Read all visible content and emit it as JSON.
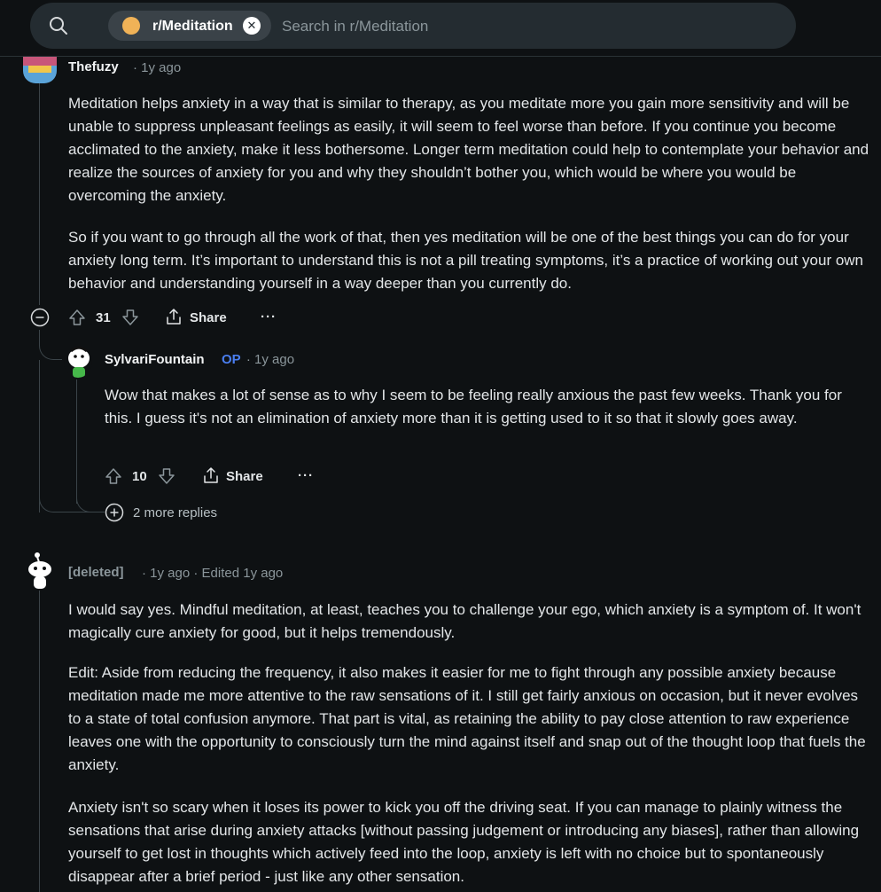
{
  "search": {
    "subreddit_chip": "r/Meditation",
    "chip_close": "✕",
    "placeholder": "Search in r/Meditation"
  },
  "comments": [
    {
      "author": "Thefuzy",
      "time": "· 1y ago",
      "paragraphs": [
        "Meditation helps anxiety in a way that is similar to therapy, as you meditate more you gain more sensitivity and will be unable to suppress unpleasant feelings as easily, it will seem to feel worse than before. If you continue you become acclimated to the anxiety, make it less bothersome. Longer term meditation could help to contemplate your behavior and realize the sources of anxiety for you and why they shouldn’t bother you, which would be where you would be overcoming the anxiety.",
        "So if you want to go through all the work of that, then yes meditation will be one of the best things you can do for your anxiety long term. It’s important to understand this is not a pill treating symptoms, it’s a practice of working out your own behavior and understanding yourself in a way deeper than you currently do."
      ],
      "score": "31",
      "share_label": "Share",
      "more_label": "···"
    },
    {
      "author": "SylvariFountain",
      "op_badge": "OP",
      "time": "· 1y ago",
      "paragraphs": [
        "Wow that makes a lot of sense as to why I seem to be feeling really anxious the past few weeks. Thank you for this. I guess it's not an elimination of anxiety more than it is getting used to it so that it slowly goes away."
      ],
      "score": "10",
      "share_label": "Share",
      "more_label": "···"
    },
    {
      "author": "[deleted]",
      "time": "· 1y ago · Edited 1y ago",
      "paragraphs": [
        "I would say yes. Mindful meditation, at least, teaches you to challenge your ego, which anxiety is a symptom of. It won't magically cure anxiety for good, but it helps tremendously.",
        "Edit: Aside from reducing the frequency, it also makes it easier for me to fight through any possible anxiety because meditation made me more attentive to the raw sensations of it. I still get fairly anxious on occasion, but it never evolves to a state of total confusion anymore. That part is vital, as retaining the ability to pay close attention to raw experience leaves one with the opportunity to consciously turn the mind against itself and snap out of the thought loop that fuels the anxiety.",
        "Anxiety isn't so scary when it loses its power to kick you off the driving seat. If you can manage to plainly witness the sensations that arise during anxiety attacks [without passing judgement or introducing any biases], rather than allowing yourself to get lost in thoughts which actively feed into the loop, anxiety is left with no choice but to spontaneously disappear after a brief period - just like any other sensation."
      ]
    }
  ],
  "more_replies": "2 more replies",
  "colors": {
    "background": "#0e1113",
    "op_badge": "#4a7ef0",
    "search_bg": "#242c31"
  }
}
